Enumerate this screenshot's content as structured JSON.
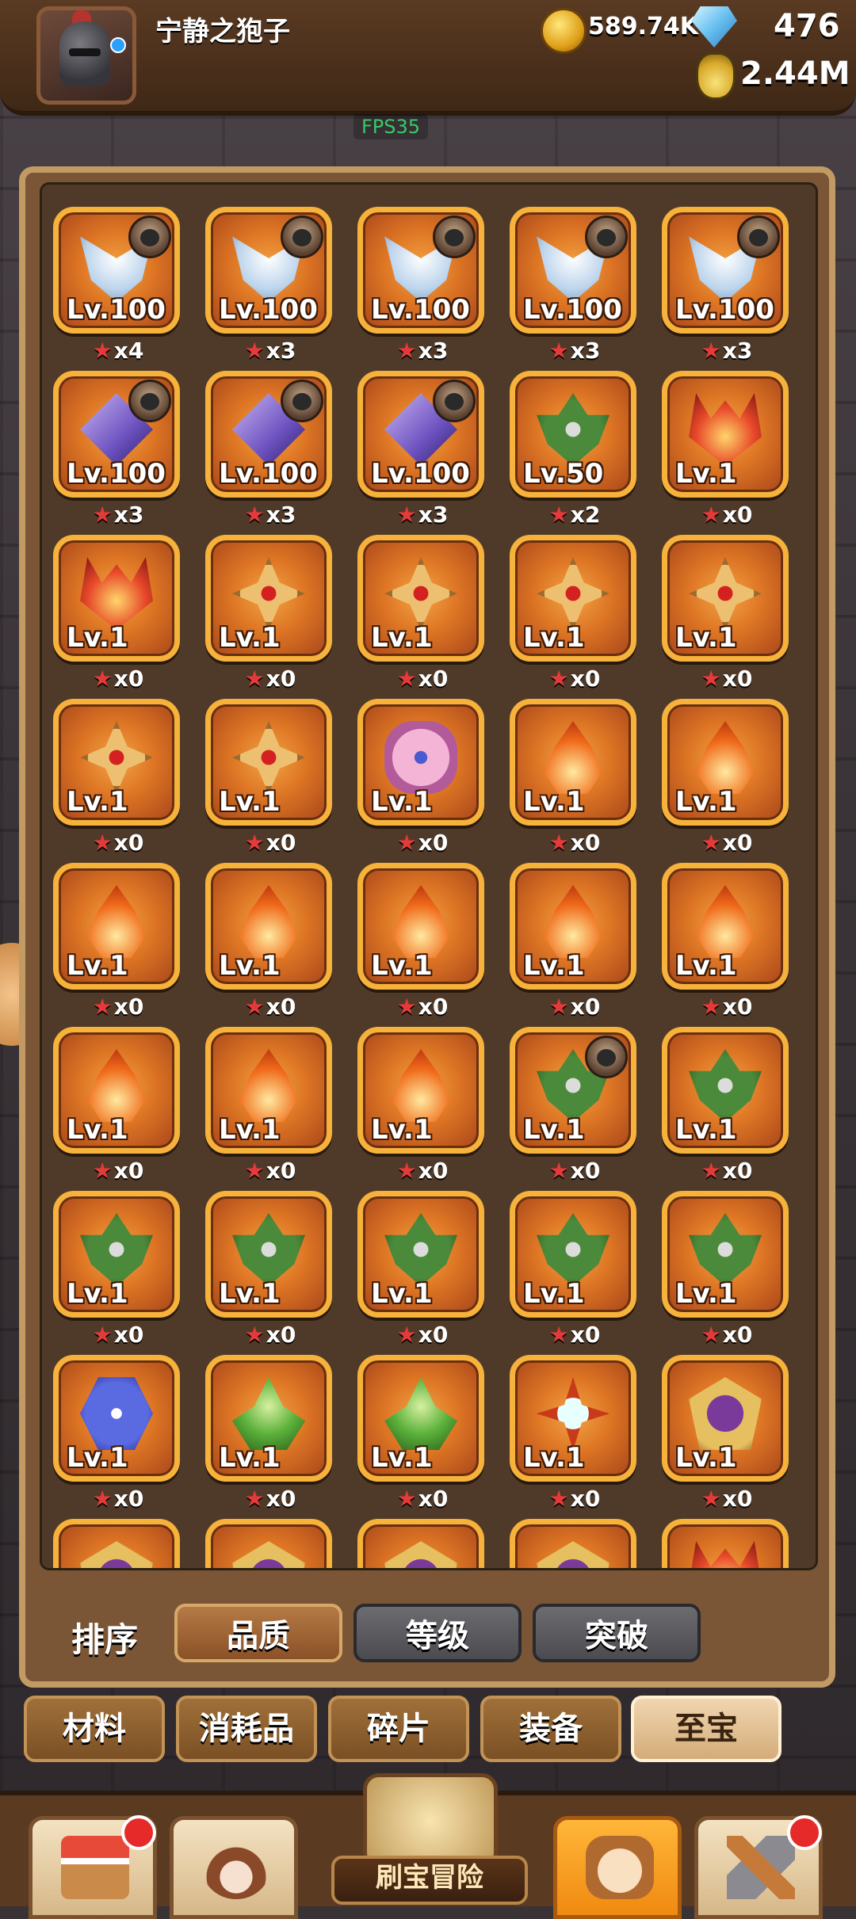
{
  "header": {
    "username": "宁静之狍子",
    "gold": "589.74K",
    "gems": "476",
    "potion": "2.44M",
    "fps": "FPS35"
  },
  "items": [
    {
      "icon": "wing-icon",
      "cls": "wing",
      "level": "Lv.100",
      "stars": "x4",
      "badge": true
    },
    {
      "icon": "wing-icon",
      "cls": "wing",
      "level": "Lv.100",
      "stars": "x3",
      "badge": true
    },
    {
      "icon": "wing-icon",
      "cls": "wing",
      "level": "Lv.100",
      "stars": "x3",
      "badge": true
    },
    {
      "icon": "wing-icon",
      "cls": "wing",
      "level": "Lv.100",
      "stars": "x3",
      "badge": true
    },
    {
      "icon": "wing-icon",
      "cls": "wing",
      "level": "Lv.100",
      "stars": "x3",
      "badge": true
    },
    {
      "icon": "spear-icon",
      "cls": "spear",
      "level": "Lv.100",
      "stars": "x3",
      "badge": true
    },
    {
      "icon": "spear-icon",
      "cls": "spear",
      "level": "Lv.100",
      "stars": "x3",
      "badge": true
    },
    {
      "icon": "spear-icon",
      "cls": "spear",
      "level": "Lv.100",
      "stars": "x3",
      "badge": true
    },
    {
      "icon": "moth-icon",
      "cls": "moth",
      "level": "Lv.50",
      "stars": "x2",
      "badge": false
    },
    {
      "icon": "horn-icon",
      "cls": "horn",
      "level": "Lv.1",
      "stars": "x0",
      "badge": false
    },
    {
      "icon": "horn-icon",
      "cls": "horn",
      "level": "Lv.1",
      "stars": "x0",
      "badge": false
    },
    {
      "icon": "shield-icon",
      "cls": "shield",
      "level": "Lv.1",
      "stars": "x0",
      "badge": false
    },
    {
      "icon": "shield-icon",
      "cls": "shield",
      "level": "Lv.1",
      "stars": "x0",
      "badge": false
    },
    {
      "icon": "shield-icon",
      "cls": "shield",
      "level": "Lv.1",
      "stars": "x0",
      "badge": false
    },
    {
      "icon": "shield-icon",
      "cls": "shield",
      "level": "Lv.1",
      "stars": "x0",
      "badge": false
    },
    {
      "icon": "shield-icon",
      "cls": "shield",
      "level": "Lv.1",
      "stars": "x0",
      "badge": false
    },
    {
      "icon": "shield-icon",
      "cls": "shield",
      "level": "Lv.1",
      "stars": "x0",
      "badge": false
    },
    {
      "icon": "flower-icon",
      "cls": "flower",
      "level": "Lv.1",
      "stars": "x0",
      "badge": false
    },
    {
      "icon": "fire-icon",
      "cls": "fire",
      "level": "Lv.1",
      "stars": "x0",
      "badge": false
    },
    {
      "icon": "fire-icon",
      "cls": "fire",
      "level": "Lv.1",
      "stars": "x0",
      "badge": false
    },
    {
      "icon": "fire-icon",
      "cls": "fire",
      "level": "Lv.1",
      "stars": "x0",
      "badge": false
    },
    {
      "icon": "fire-icon",
      "cls": "fire",
      "level": "Lv.1",
      "stars": "x0",
      "badge": false
    },
    {
      "icon": "fire-icon",
      "cls": "fire",
      "level": "Lv.1",
      "stars": "x0",
      "badge": false
    },
    {
      "icon": "fire-icon",
      "cls": "fire",
      "level": "Lv.1",
      "stars": "x0",
      "badge": false
    },
    {
      "icon": "fire-icon",
      "cls": "fire",
      "level": "Lv.1",
      "stars": "x0",
      "badge": false
    },
    {
      "icon": "fire-icon",
      "cls": "fire",
      "level": "Lv.1",
      "stars": "x0",
      "badge": false
    },
    {
      "icon": "fire-icon",
      "cls": "fire",
      "level": "Lv.1",
      "stars": "x0",
      "badge": false
    },
    {
      "icon": "fire-icon",
      "cls": "fire",
      "level": "Lv.1",
      "stars": "x0",
      "badge": false
    },
    {
      "icon": "moth-icon",
      "cls": "moth",
      "level": "Lv.1",
      "stars": "x0",
      "badge": true
    },
    {
      "icon": "moth-icon",
      "cls": "moth",
      "level": "Lv.1",
      "stars": "x0",
      "badge": false
    },
    {
      "icon": "moth-icon",
      "cls": "moth",
      "level": "Lv.1",
      "stars": "x0",
      "badge": false
    },
    {
      "icon": "moth-icon",
      "cls": "moth",
      "level": "Lv.1",
      "stars": "x0",
      "badge": false
    },
    {
      "icon": "moth-icon",
      "cls": "moth",
      "level": "Lv.1",
      "stars": "x0",
      "badge": false
    },
    {
      "icon": "moth-icon",
      "cls": "moth",
      "level": "Lv.1",
      "stars": "x0",
      "badge": false
    },
    {
      "icon": "moth-icon",
      "cls": "moth",
      "level": "Lv.1",
      "stars": "x0",
      "badge": false
    },
    {
      "icon": "snowflake-icon",
      "cls": "snow",
      "level": "Lv.1",
      "stars": "x0",
      "badge": false
    },
    {
      "icon": "plant-icon",
      "cls": "plant",
      "level": "Lv.1",
      "stars": "x0",
      "badge": false
    },
    {
      "icon": "plant-icon",
      "cls": "plant",
      "level": "Lv.1",
      "stars": "x0",
      "badge": false
    },
    {
      "icon": "crystal-icon",
      "cls": "crystal",
      "level": "Lv.1",
      "stars": "x0",
      "badge": false
    },
    {
      "icon": "star-badge-icon",
      "cls": "badgeart",
      "level": "Lv.1",
      "stars": "x0",
      "badge": false
    },
    {
      "icon": "star-badge-icon",
      "cls": "badgeart",
      "level": "",
      "stars": "",
      "badge": false
    },
    {
      "icon": "star-badge-icon",
      "cls": "badgeart",
      "level": "",
      "stars": "",
      "badge": false
    },
    {
      "icon": "star-badge-icon",
      "cls": "badgeart",
      "level": "",
      "stars": "",
      "badge": false
    },
    {
      "icon": "star-badge-icon",
      "cls": "badgeart",
      "level": "",
      "stars": "",
      "badge": false
    },
    {
      "icon": "horn-icon",
      "cls": "horn",
      "level": "",
      "stars": "",
      "badge": false
    }
  ],
  "sort": {
    "label": "排序",
    "options": [
      {
        "label": "品质",
        "active": true
      },
      {
        "label": "等级",
        "active": false
      },
      {
        "label": "突破",
        "active": false
      }
    ]
  },
  "tabs": [
    {
      "label": "材料",
      "active": false
    },
    {
      "label": "消耗品",
      "active": false
    },
    {
      "label": "碎片",
      "active": false
    },
    {
      "label": "装备",
      "active": false
    },
    {
      "label": "至宝",
      "active": true
    }
  ],
  "bottom_nav": {
    "adventure_label": "刷宝冒险"
  }
}
